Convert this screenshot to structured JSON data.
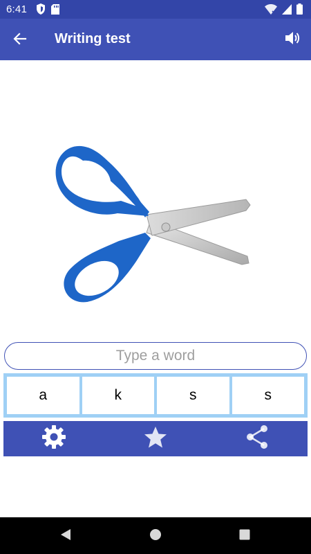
{
  "status_bar": {
    "time": "6:41",
    "left_icons": [
      "shield-icon",
      "sd-card-icon"
    ],
    "right_icons": [
      "wifi-icon",
      "signal-icon",
      "battery-icon"
    ]
  },
  "app_bar": {
    "title": "Writing test",
    "back_icon": "arrow-back-icon",
    "sound_icon": "volume-icon",
    "color": "#3f51b5"
  },
  "picture": {
    "subject_icon": "scissors-icon"
  },
  "input": {
    "placeholder": "Type a word",
    "value": ""
  },
  "letters": [
    "a",
    "k",
    "s",
    "s"
  ],
  "toolbar": {
    "icons": [
      "settings-icon",
      "star-icon",
      "share-icon"
    ]
  },
  "colors": {
    "primary": "#3f51b5",
    "status_bar": "#3345a8",
    "letters_panel": "#9fd0f5"
  }
}
